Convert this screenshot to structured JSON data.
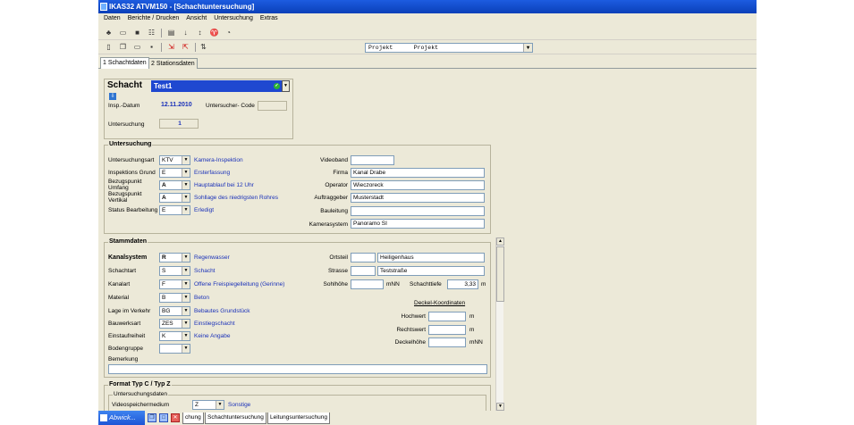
{
  "window": {
    "title": "IKAS32 ATVM150 - [Schachtuntersuchung]"
  },
  "menu": [
    "Daten",
    "Berichte / Drucken",
    "Ansicht",
    "Untersuchung",
    "Extras"
  ],
  "project_combo": {
    "value": "Projekt      Projekt"
  },
  "tabs": {
    "tab1": "1 Schachtdaten",
    "tab2": "2 Stationsdaten"
  },
  "schacht": {
    "label": "Schacht",
    "value": "Test1",
    "insp_datum_label": "Insp.-Datum",
    "insp_datum": "12.11.2010",
    "untersucher_code_label": "Untersucher- Code",
    "untersucher_code": "",
    "untersuchung_label": "Untersuchung",
    "untersuchung": "1"
  },
  "untersuchung": {
    "title": "Untersuchung",
    "untersuchungsart_label": "Untersuchungsart",
    "untersuchungsart_code": "KTV",
    "untersuchungsart_text": "Kamera-Inspektion",
    "grund_label": "Inspektions Grund",
    "grund_code": "E",
    "grund_text": "Ersterfassung",
    "umfang_label1": "Bezugspunkt",
    "umfang_label2": "Umfang",
    "umfang_code": "A",
    "umfang_text": "Hauptablauf bei 12 Uhr",
    "vertikal_label1": "Bezugspunkt",
    "vertikal_label2": "Vertikal",
    "vertikal_code": "A",
    "vertikal_text": "Sohllage des niedrigsten Rohres",
    "status_label": "Status Bearbeitung",
    "status_code": "E",
    "status_text": "Erledigt",
    "videoband_label": "Videoband",
    "videoband": "",
    "firma_label": "Firma",
    "firma": "Kanal Drabe",
    "operator_label": "Operator",
    "operator": "Wieczoreck",
    "auftraggeber_label": "Auftraggeber",
    "auftraggeber": "Musterstadt",
    "bauleitung_label": "Bauleitung",
    "bauleitung": "",
    "kamerasystem_label": "Kamerasystem",
    "kamerasystem": "Panoramo SI"
  },
  "stammdaten": {
    "title": "Stammdaten",
    "kanalsystem_label": "Kanalsystem",
    "kanalsystem_code": "R",
    "kanalsystem_text": "Regenwasser",
    "schachtart_label": "Schachtart",
    "schachtart_code": "S",
    "schachtart_text": "Schacht",
    "kanalart_label": "Kanalart",
    "kanalart_code": "F",
    "kanalart_text": "Offene Freispiegelleitung (Gerinne)",
    "material_label": "Material",
    "material_code": "B",
    "material_text": "Beton",
    "lage_label": "Lage im Verkehr",
    "lage_code": "BG",
    "lage_text": "Bebautes Grundstück",
    "bauwerksart_label": "Bauwerksart",
    "bauwerksart_code": "ZES",
    "bauwerksart_text": "Einstiegschacht",
    "einstaufreiheit_label": "Einstaufreiheit",
    "einstaufreiheit_code": "K",
    "einstaufreiheit_text": "Keine Angabe",
    "bodengruppe_label": "Bodengruppe",
    "bodengruppe_code": "",
    "bemerkung_label": "Bemerkung",
    "bemerkung": "",
    "ortsteil_label": "Ortsteil",
    "ortsteil_code": "",
    "ortsteil": "Heiligenhaus",
    "strasse_label": "Strasse",
    "strasse_code": "",
    "strasse": "Teststraße",
    "sohlhoehe_label": "Sohlhöhe",
    "sohlhoehe": "",
    "sohlhoehe_unit": "mNN",
    "schachttiefe_label": "Schachttiefe",
    "schachttiefe": "3,33",
    "schachttiefe_unit": "m",
    "deckel_title": "Deckel-Koordinaten",
    "hochwert_label": "Hochwert",
    "hochwert": "",
    "hochwert_unit": "m",
    "rechtswert_label": "Rechtswert",
    "rechtswert": "",
    "rechtswert_unit": "m",
    "deckelhoehe_label": "Deckelhöhe",
    "deckelhoehe": "",
    "deckelhoehe_unit": "mNN"
  },
  "format": {
    "title": "Format Typ C / Typ Z",
    "sub_title": "Untersuchungsdaten",
    "videospeicher_label": "Videospeichermedium",
    "videospeicher_code": "Z",
    "videospeicher_text": "Sonstige"
  },
  "taskbar": {
    "start_label": "Abwick...",
    "tab1": "chung",
    "tab2": "Schachtuntersuchung",
    "tab3": "Leitungsuntersuchung"
  }
}
